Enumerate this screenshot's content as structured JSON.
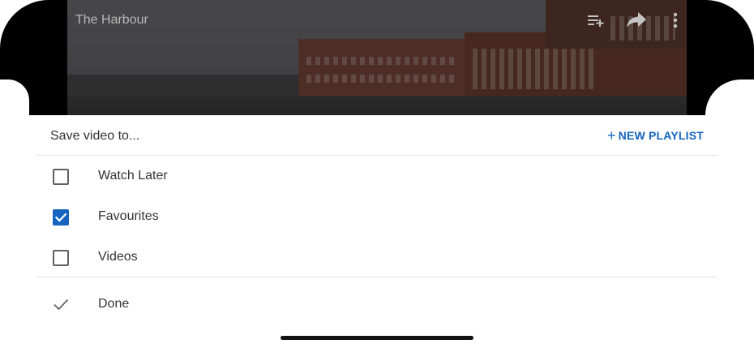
{
  "video": {
    "title": "The Harbour",
    "icons": [
      "add-to-queue-icon",
      "share-icon",
      "more-vert-icon"
    ]
  },
  "sheet": {
    "title": "Save video to...",
    "new_playlist_label": "NEW PLAYLIST",
    "options": [
      {
        "label": "Watch Later",
        "checked": false
      },
      {
        "label": "Favourites",
        "checked": true
      },
      {
        "label": "Videos",
        "checked": false
      }
    ],
    "done_label": "Done"
  },
  "colors": {
    "accent": "#1565c0",
    "text": "#333333",
    "divider": "#e2e2e2"
  }
}
